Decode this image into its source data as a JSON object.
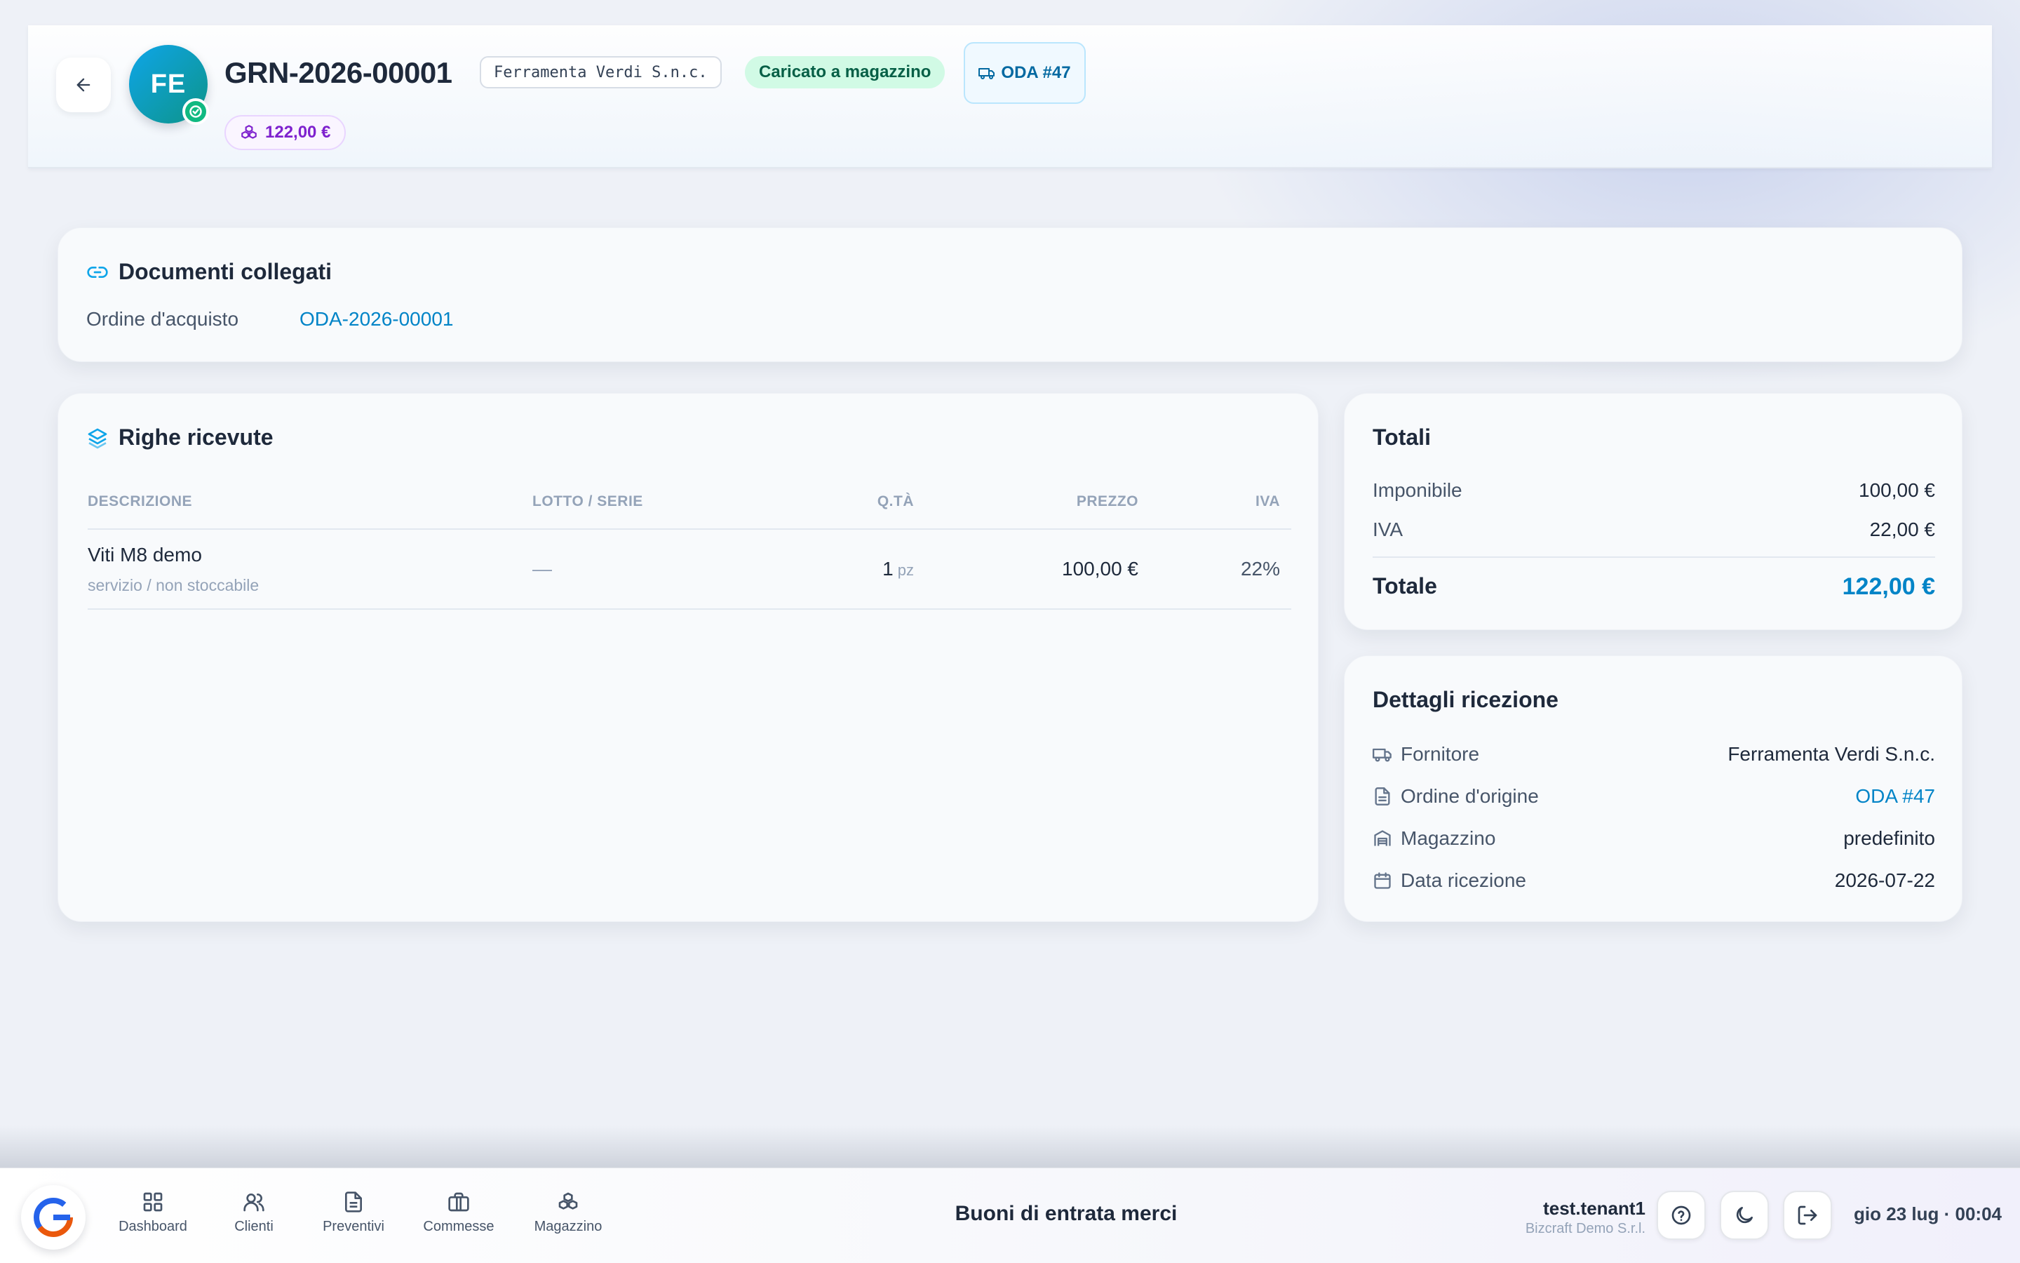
{
  "header": {
    "avatar_initials": "FE",
    "document_number": "GRN-2026-00001",
    "supplier_chip": "Ferramenta Verdi S.n.c.",
    "status_label": "Caricato a magazzino",
    "order_chip": "ODA #47",
    "amount_chip": "122,00 €"
  },
  "linked_documents": {
    "title": "Documenti collegati",
    "label": "Ordine d'acquisto",
    "value": "ODA-2026-00001"
  },
  "received_lines": {
    "title": "Righe ricevute",
    "columns": {
      "description": "DESCRIZIONE",
      "lot": "LOTTO / SERIE",
      "qty": "Q.TÀ",
      "price": "PREZZO",
      "vat": "IVA"
    },
    "rows": [
      {
        "description": "Viti M8 demo",
        "note": "servizio / non stoccabile",
        "lot": "—",
        "qty": "1",
        "unit": "pz",
        "price": "100,00 €",
        "vat": "22%"
      }
    ]
  },
  "totals": {
    "title": "Totali",
    "taxable_label": "Imponibile",
    "taxable_value": "100,00 €",
    "vat_label": "IVA",
    "vat_value": "22,00 €",
    "total_label": "Totale",
    "total_value": "122,00 €"
  },
  "details": {
    "title": "Dettagli ricezione",
    "supplier_label": "Fornitore",
    "supplier_value": "Ferramenta Verdi S.n.c.",
    "order_label": "Ordine d'origine",
    "order_value": "ODA #47",
    "warehouse_label": "Magazzino",
    "warehouse_value": "predefinito",
    "date_label": "Data ricezione",
    "date_value": "2026-07-22"
  },
  "bottom_bar": {
    "nav": [
      "Dashboard",
      "Clienti",
      "Preventivi",
      "Commesse",
      "Magazzino"
    ],
    "page_title": "Buoni di entrata merci",
    "user_name": "test.tenant1",
    "user_org": "Bizcraft Demo S.r.l.",
    "clock": "gio 23 lug · 00:04"
  },
  "colors": {
    "accent": "#0284c7",
    "status_bg": "#d1fae5",
    "status_text": "#065f46",
    "amount_text": "#7e22ce",
    "avatar_from": "#0ea5e9",
    "avatar_to": "#0d9488"
  },
  "icons": {
    "back": "arrow-left-icon",
    "verified": "check-circle-icon",
    "order": "truck-icon",
    "amount": "boxes-icon",
    "linked": "link-icon",
    "lines": "layers-icon",
    "supplier": "truck-icon",
    "origin_order": "file-text-icon",
    "warehouse": "warehouse-icon",
    "date": "calendar-icon",
    "help": "help-circle-icon",
    "theme": "moon-icon",
    "logout": "log-out-icon"
  }
}
